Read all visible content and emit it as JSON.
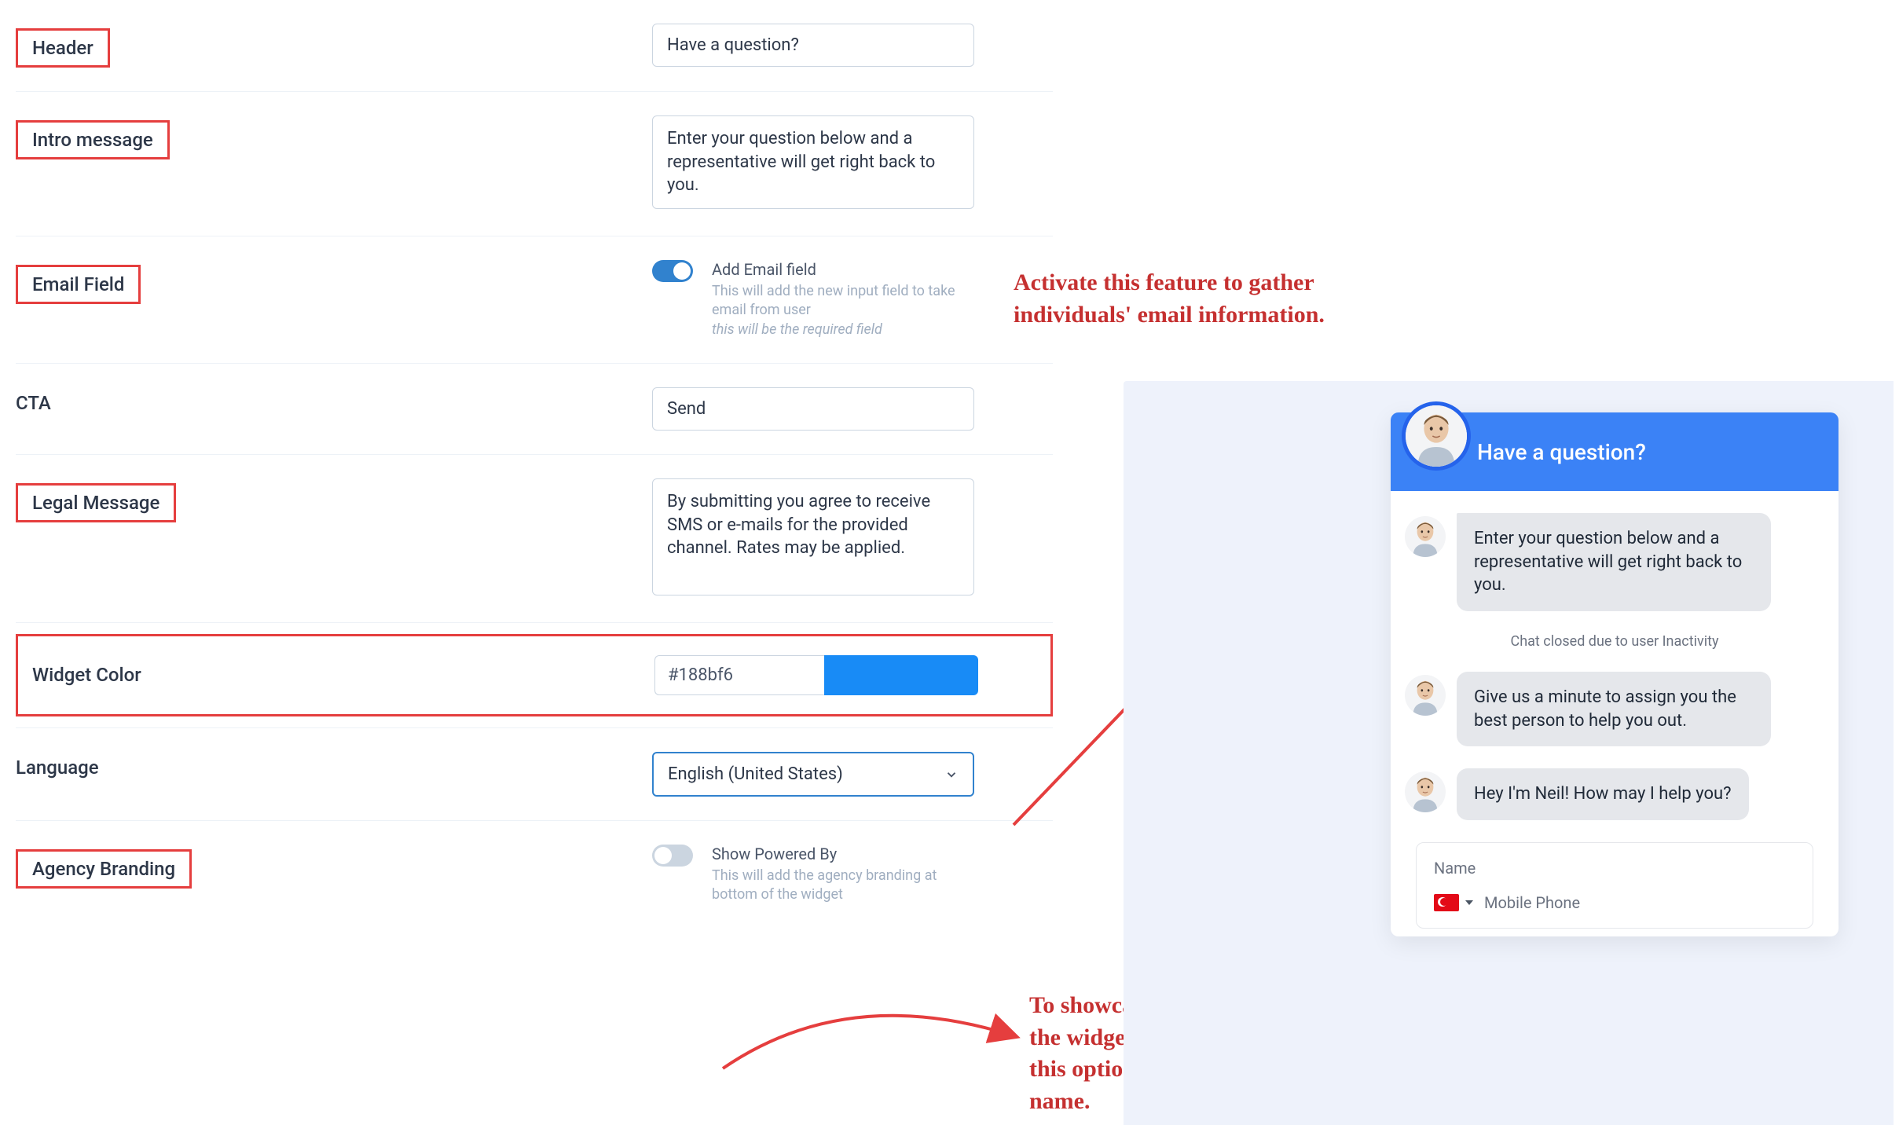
{
  "form": {
    "header": {
      "label": "Header",
      "value": "Have a question?"
    },
    "intro": {
      "label": "Intro message",
      "value": "Enter your question below and a representative will get right back to you."
    },
    "email": {
      "label": "Email Field",
      "toggle_on": true,
      "title": "Add Email field",
      "desc": "This will add the new input field to take email from user",
      "desc_italic": "this will be the required field"
    },
    "cta": {
      "label": "CTA",
      "value": "Send"
    },
    "legal": {
      "label": "Legal Message",
      "value": "By submitting you agree to receive SMS or e-mails for the provided channel. Rates may be applied."
    },
    "color": {
      "label": "Widget Color",
      "value": "#188bf6"
    },
    "language": {
      "label": "Language",
      "value": "English (United States)"
    },
    "branding": {
      "label": "Agency Branding",
      "toggle_on": false,
      "title": "Show Powered By",
      "desc": "This will add the agency branding at bottom of the widget"
    }
  },
  "annotations": {
    "email": "Activate this feature to gather individuals' email information.",
    "branding": "To showcase your agency's name at the widget's bottom, simply activate this option and input your company's name."
  },
  "preview": {
    "header": "Have a question?",
    "messages": [
      "Enter your question below and a representative will get right back to you.",
      "Give us a minute to assign you the best person to help you out.",
      "Hey I'm Neil! How may I help you?"
    ],
    "status": "Chat closed due to user Inactivity",
    "form": {
      "name_label": "Name",
      "phone_placeholder": "Mobile Phone"
    }
  }
}
